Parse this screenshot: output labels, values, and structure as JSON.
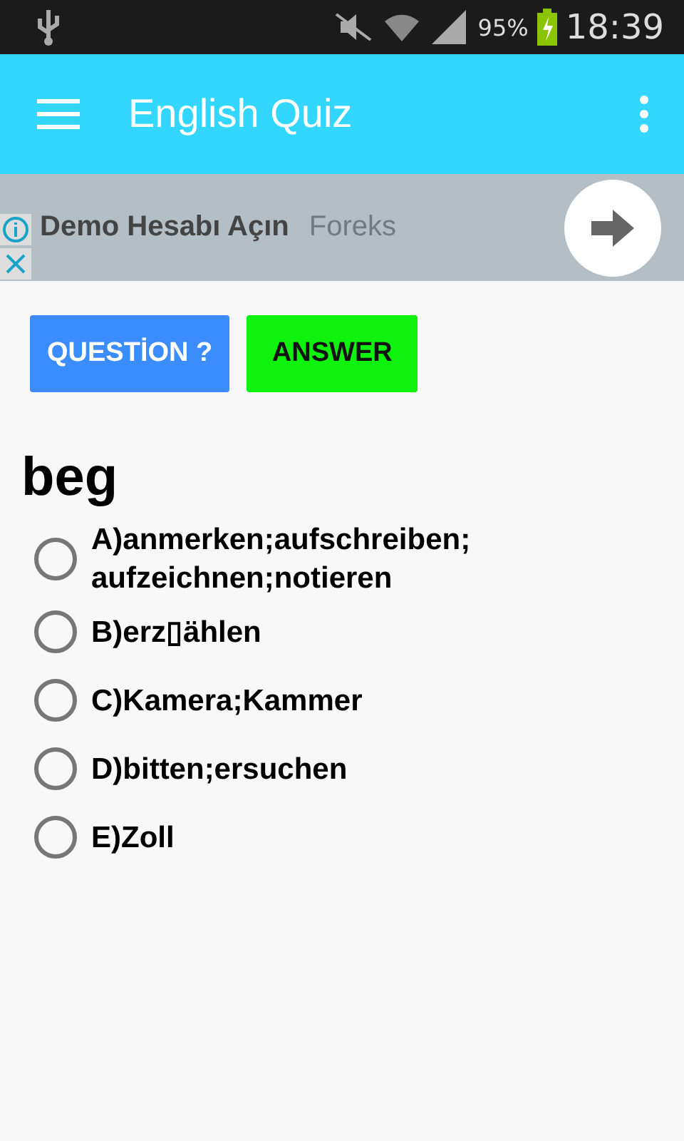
{
  "status_bar": {
    "battery": "95%",
    "time": "18:39"
  },
  "app_bar": {
    "title": "English Quiz"
  },
  "ad": {
    "headline": "Demo Hesabı Açın",
    "faded": "Foreks"
  },
  "buttons": [
    {
      "kind": "question",
      "label": "QUESTİON ?"
    },
    {
      "kind": "answer",
      "label": "ANSWER"
    }
  ],
  "word": "beg",
  "options": [
    {
      "label": "A)anmerken;aufschreiben; aufzeichnen;notieren",
      "selected": false
    },
    {
      "label": "B)erz▯ählen",
      "selected": false
    },
    {
      "label": "C)Kamera;Kammer",
      "selected": false
    },
    {
      "label": "D)bitten;ersuchen",
      "selected": false
    },
    {
      "label": "E)Zoll",
      "selected": false
    }
  ]
}
